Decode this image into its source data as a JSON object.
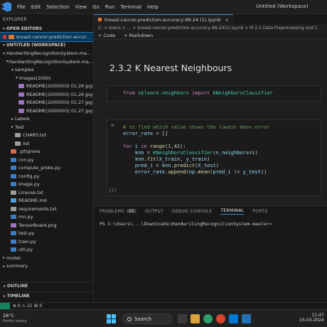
{
  "menubar": {
    "items": [
      "File",
      "Edit",
      "Selection",
      "View",
      "Go",
      "Run",
      "Terminal",
      "Help"
    ],
    "window_title": "Untitled (Workspace)"
  },
  "sidebar": {
    "title": "EXPLORER",
    "open_editors_label": "OPEN EDITORS",
    "open_editor_file": "breast-cancer-prediction-accur...",
    "workspace_label": "UNTITLED (WORKSPACE)",
    "tree": [
      {
        "label": "HandwritingRecognitionSystem-ma...",
        "depth": 0,
        "kind": "folder",
        "open": true
      },
      {
        "label": "HandwritingRecognitionSystem-ma...",
        "depth": 1,
        "kind": "folder",
        "open": true
      },
      {
        "label": "samples",
        "depth": 2,
        "kind": "folder",
        "open": true
      },
      {
        "label": "Images(1000)",
        "depth": 3,
        "kind": "folder",
        "open": true
      },
      {
        "label": "README(1000003) 01.26 jpg  Ima...",
        "depth": 4,
        "kind": "img"
      },
      {
        "label": "README(1000003) 01.26 jpg  Ima...",
        "depth": 4,
        "kind": "img"
      },
      {
        "label": "README(1000003) 01.27 jpg  Ima...",
        "depth": 4,
        "kind": "img"
      },
      {
        "label": "README(1000003) 01.27 jpg  Ima...",
        "depth": 4,
        "kind": "img"
      },
      {
        "label": "Labels",
        "depth": 2,
        "kind": "folder",
        "open": false
      },
      {
        "label": "Test",
        "depth": 2,
        "kind": "folder",
        "open": false
      },
      {
        "label": "CHARS.txt",
        "depth": 2,
        "kind": "txt"
      },
      {
        "label": "list",
        "depth": 2,
        "kind": "txt"
      },
      {
        "label": ".gitignore",
        "depth": 1,
        "kind": "git"
      },
      {
        "label": "cnn.py",
        "depth": 1,
        "kind": "py"
      },
      {
        "label": "compute_probs.py",
        "depth": 1,
        "kind": "py"
      },
      {
        "label": "config.py",
        "depth": 1,
        "kind": "py"
      },
      {
        "label": "image.py",
        "depth": 1,
        "kind": "py"
      },
      {
        "label": "License.txt",
        "depth": 1,
        "kind": "txt"
      },
      {
        "label": "README.md",
        "depth": 1,
        "kind": "md"
      },
      {
        "label": "requirements.txt",
        "depth": 1,
        "kind": "txt"
      },
      {
        "label": "rnn.py",
        "depth": 1,
        "kind": "py"
      },
      {
        "label": "TensorBoard.png",
        "depth": 1,
        "kind": "img"
      },
      {
        "label": "test.py",
        "depth": 1,
        "kind": "py"
      },
      {
        "label": "train.py",
        "depth": 1,
        "kind": "py"
      },
      {
        "label": "util.py",
        "depth": 1,
        "kind": "py"
      },
      {
        "label": "model",
        "depth": 0,
        "kind": "folder",
        "open": false
      },
      {
        "label": "summary",
        "depth": 0,
        "kind": "folder",
        "open": false
      }
    ],
    "outline_label": "OUTLINE",
    "timeline_label": "TIMELINE"
  },
  "editor": {
    "tab_label": "breast-cancer-prediction-accuracy-98-24 (1).ipynb",
    "breadcrumb": "C: > Users > ... > breast-cancer-prediction-accuracy-98-24(1).ipynb > M 2.2 Data Preprocessing and C",
    "toolbar": {
      "code": "+ Code",
      "markdown": "+ Markdown"
    },
    "heading": "2.3.2 K Nearest Neighbours",
    "cell1": {
      "line": "from sklearn.neighbors import KNeighborsClassifier"
    },
    "cell2": {
      "lines": [
        "# to find which value shows the lowest mean error",
        "error_rate = []",
        "",
        "for i in range(1,42):",
        "    knn = KNeighborsClassifier(n_neighbors=i)",
        "    knn.fit(X_train, y_train)",
        "    pred_i = knn.predict(X_test)",
        "    error_rate.append(np.mean(pred_i != y_test))"
      ],
      "exec_count": "[2]"
    }
  },
  "panel": {
    "tabs": [
      "PROBLEMS",
      "OUTPUT",
      "DEBUG CONSOLE",
      "TERMINAL",
      "PORTS"
    ],
    "problems_count": "11",
    "active_tab": "TERMINAL",
    "terminal_line": "PS C:\\Users\\...\\Downloads\\HandwritingRecognitionSystem-master>"
  },
  "statusbar": {
    "left": "⊗ 0 ⚠ 11    ⌘ 0"
  },
  "taskbar": {
    "weather_temp": "28°C",
    "weather_desc": "Partly sunny",
    "search_placeholder": "Search",
    "clock_time": "11:47",
    "clock_date": "15-03-2024"
  }
}
